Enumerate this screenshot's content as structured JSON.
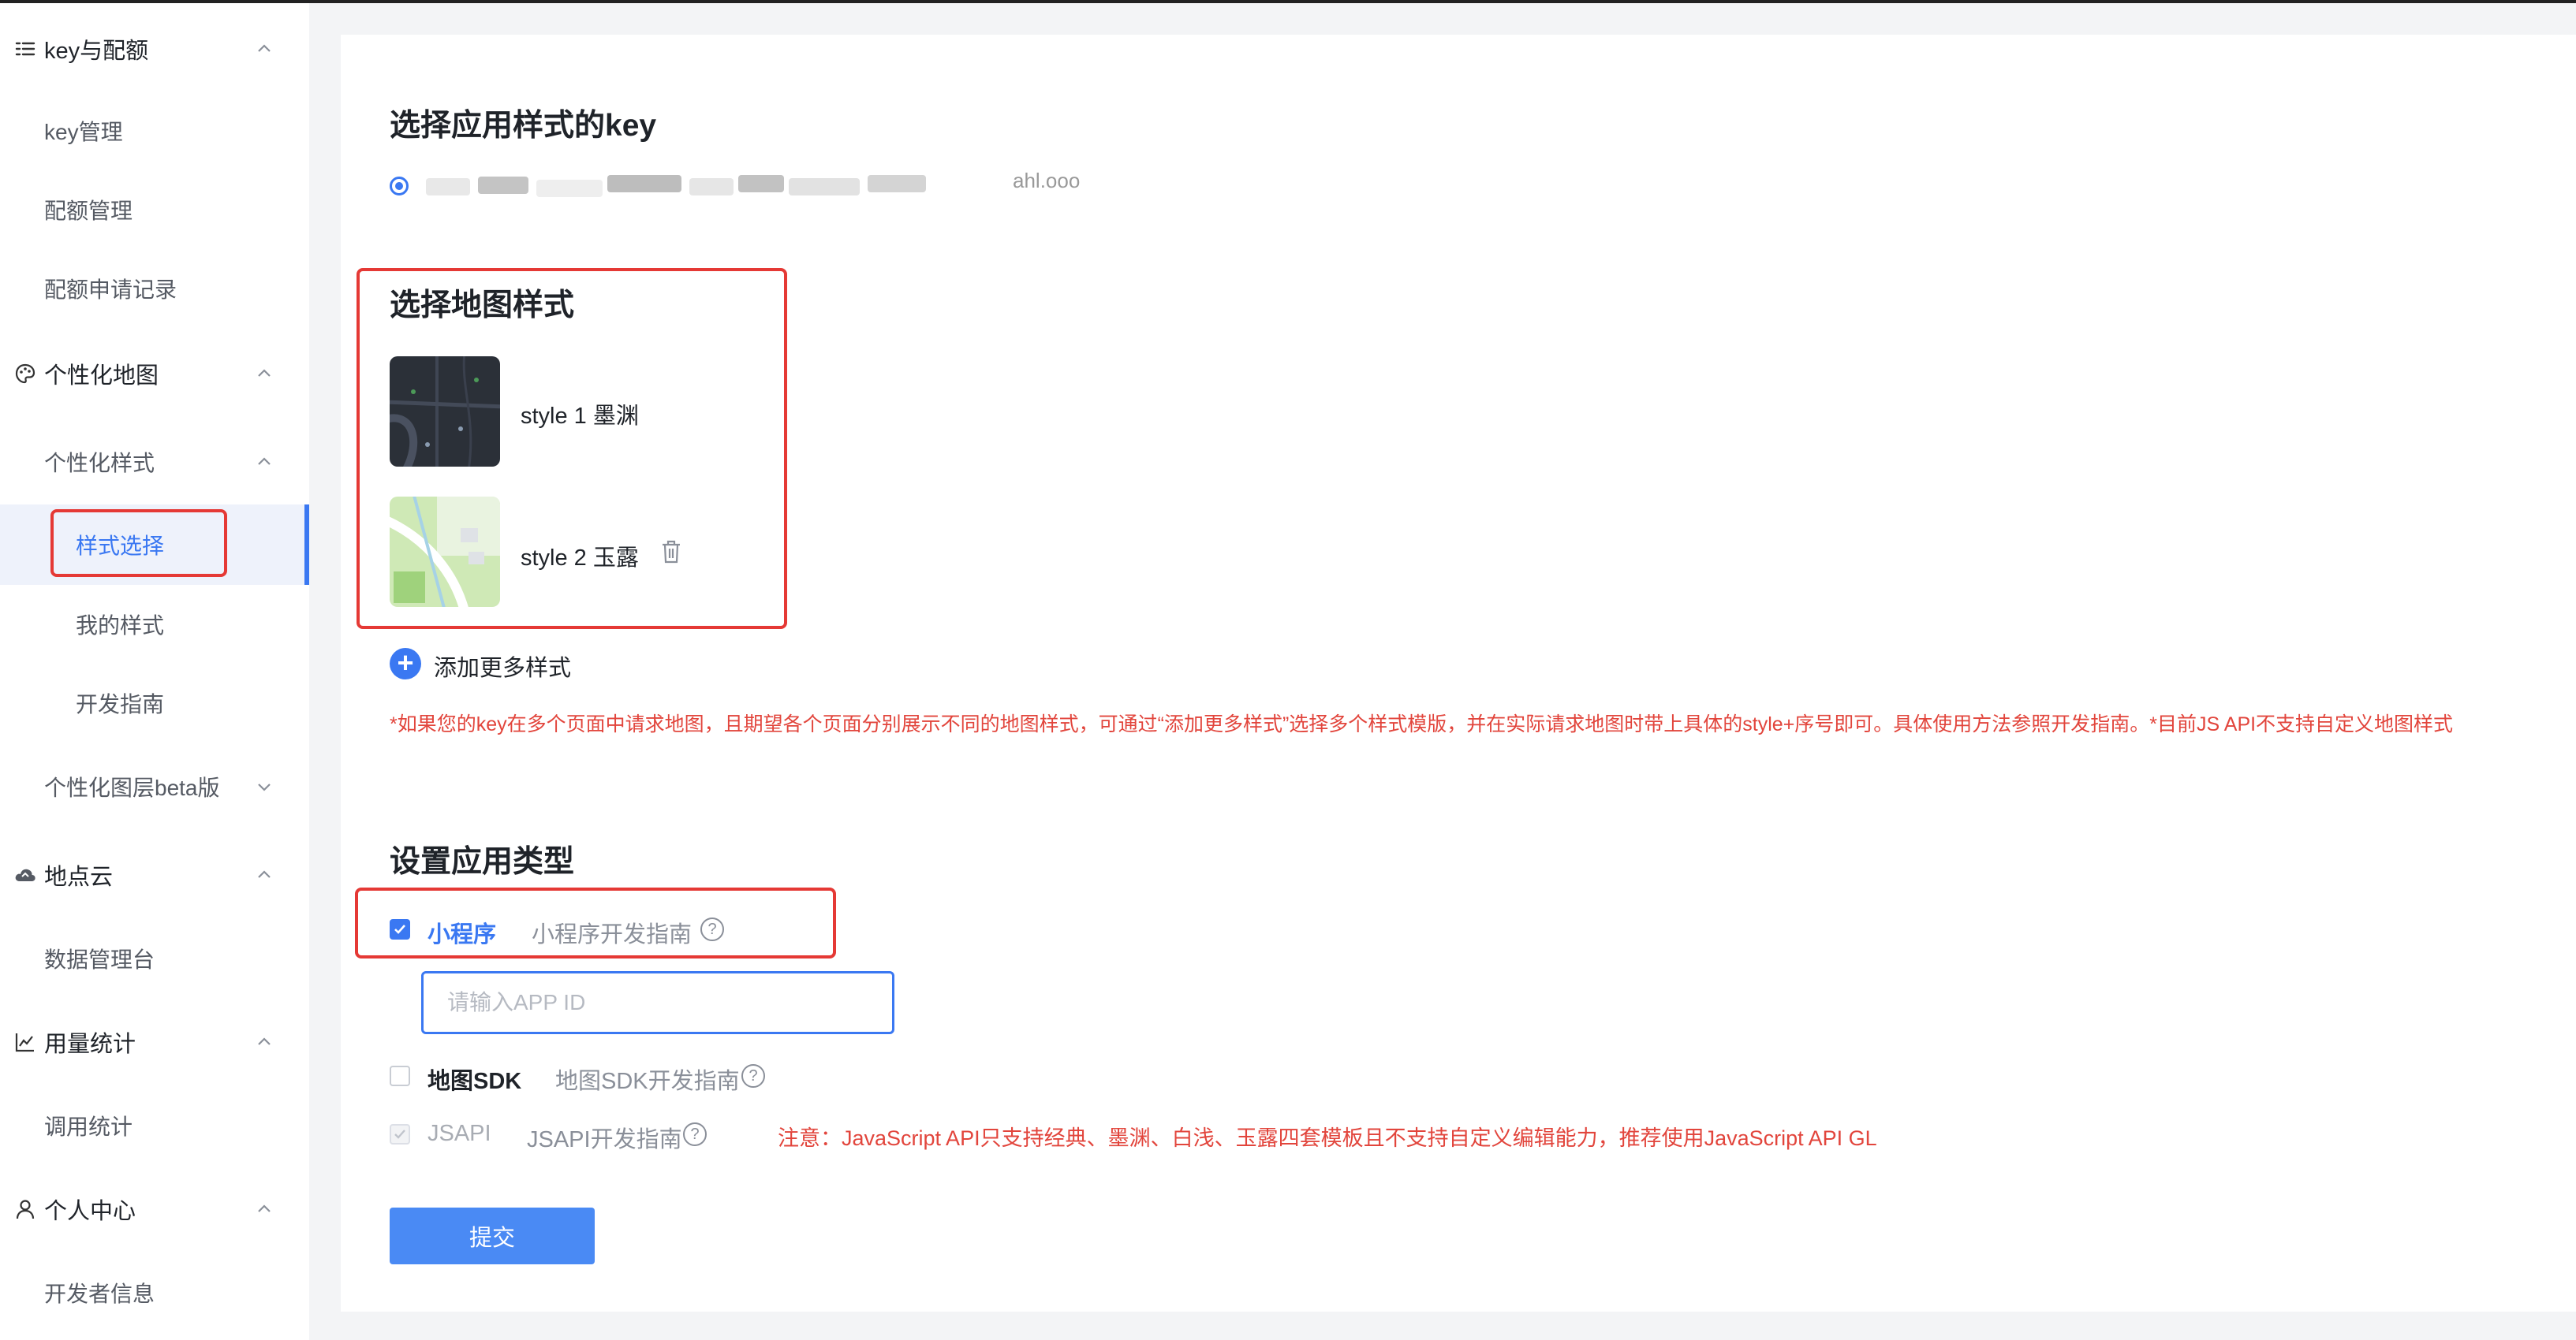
{
  "sidebar": {
    "groups": [
      {
        "label": "key与配额",
        "icon": "list-icon"
      },
      {
        "label": "个性化地图",
        "icon": "palette-icon"
      },
      {
        "label": "地点云",
        "icon": "cloud-icon"
      },
      {
        "label": "用量统计",
        "icon": "chart-line-icon"
      },
      {
        "label": "个人中心",
        "icon": "user-icon"
      }
    ],
    "items": {
      "key_manage": "key管理",
      "quota_manage": "配额管理",
      "quota_records": "配额申请记录",
      "custom_style": "个性化样式",
      "style_select": "样式选择",
      "my_styles": "我的样式",
      "dev_guide": "开发指南",
      "custom_layer_beta": "个性化图层beta版",
      "data_console": "数据管理台",
      "call_stats": "调用统计",
      "developer_info": "开发者信息"
    }
  },
  "main": {
    "key_section": {
      "title": "选择应用样式的key",
      "selected_key_partial": "ahl.ooo"
    },
    "style_section": {
      "title": "选择地图样式",
      "styles": [
        {
          "label": "style 1 墨渊",
          "thumb_icon": "dark-map-thumbnail"
        },
        {
          "label": "style 2 玉露",
          "thumb_icon": "green-map-thumbnail",
          "delete_icon": "trash-icon"
        }
      ],
      "add_more": "添加更多样式",
      "note": "*如果您的key在多个页面中请求地图，且期望各个页面分别展示不同的地图样式，可通过“添加更多样式”选择多个样式模版，并在实际请求地图时带上具体的style+序号即可。具体使用方法参照开发指南。*目前JS API不支持自定义地图样式"
    },
    "app_type_section": {
      "title": "设置应用类型",
      "miniprogram": {
        "label": "小程序",
        "guide": "小程序开发指南",
        "checked": true
      },
      "appid_placeholder": "请输入APP ID",
      "map_sdk": {
        "label": "地图SDK",
        "guide": "地图SDK开发指南",
        "checked": false
      },
      "jsapi": {
        "label": "JSAPI",
        "guide": "JSAPI开发指南",
        "checked": true,
        "disabled": true
      },
      "jsapi_warning": "注意：JavaScript API只支持经典、墨渊、白浅、玉露四套模板且不支持自定义编辑能力，推荐使用JavaScript API GL"
    },
    "submit_label": "提交"
  },
  "colors": {
    "accent": "#3a78f2",
    "warning": "#e2453c",
    "highlight_box": "#e53935"
  }
}
